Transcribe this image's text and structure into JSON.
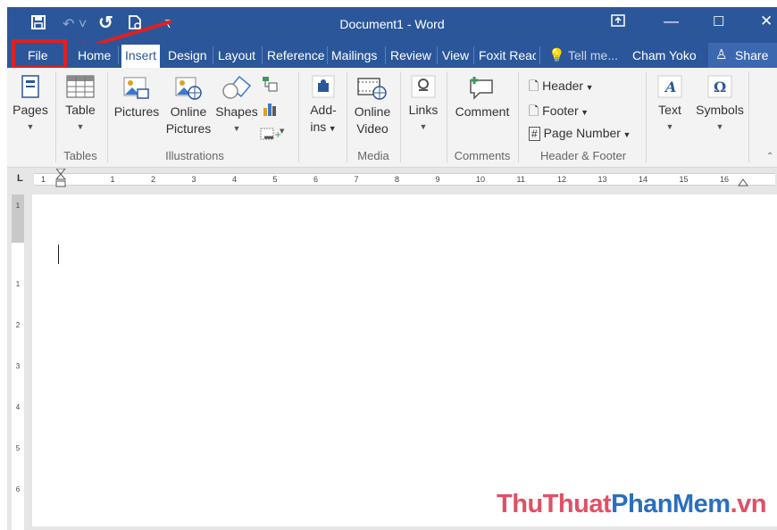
{
  "titlebar": {
    "title": "Document1 - Word"
  },
  "tabs": [
    {
      "label": "File"
    },
    {
      "label": "Home"
    },
    {
      "label": "Insert"
    },
    {
      "label": "Design"
    },
    {
      "label": "Layout"
    },
    {
      "label": "Reference"
    },
    {
      "label": "Mailings"
    },
    {
      "label": "Review"
    },
    {
      "label": "View"
    },
    {
      "label": "Foxit Reac"
    }
  ],
  "tellme": "Tell me...",
  "user": "Cham Yoko",
  "share": "Share",
  "ribbon": {
    "pages": "Pages",
    "table": "Table",
    "pictures": "Pictures",
    "online_pictures_1": "Online",
    "online_pictures_2": "Pictures",
    "shapes": "Shapes",
    "addins_1": "Add-",
    "addins_2": "ins",
    "online_video_1": "Online",
    "online_video_2": "Video",
    "links": "Links",
    "comment": "Comment",
    "header": "Header",
    "footer": "Footer",
    "page_number": "Page Number",
    "text": "Text",
    "symbols": "Symbols"
  },
  "groups": {
    "tables": "Tables",
    "illustrations": "Illustrations",
    "media": "Media",
    "comments": "Comments",
    "header_footer": "Header & Footer"
  },
  "ruler": {
    "h_numbers": [
      "1",
      "1",
      "2",
      "3",
      "4",
      "5",
      "6",
      "7",
      "8",
      "9",
      "10",
      "11",
      "12",
      "13",
      "14",
      "15",
      "16"
    ],
    "v_numbers": [
      "1",
      "1",
      "2",
      "3",
      "4",
      "5",
      "6"
    ]
  },
  "watermark": {
    "part1": "ThuThuat",
    "part2": "PhanMem",
    "part3": ".vn"
  },
  "colors": {
    "word_blue": "#2b579a",
    "highlight_red": "#e02020"
  }
}
